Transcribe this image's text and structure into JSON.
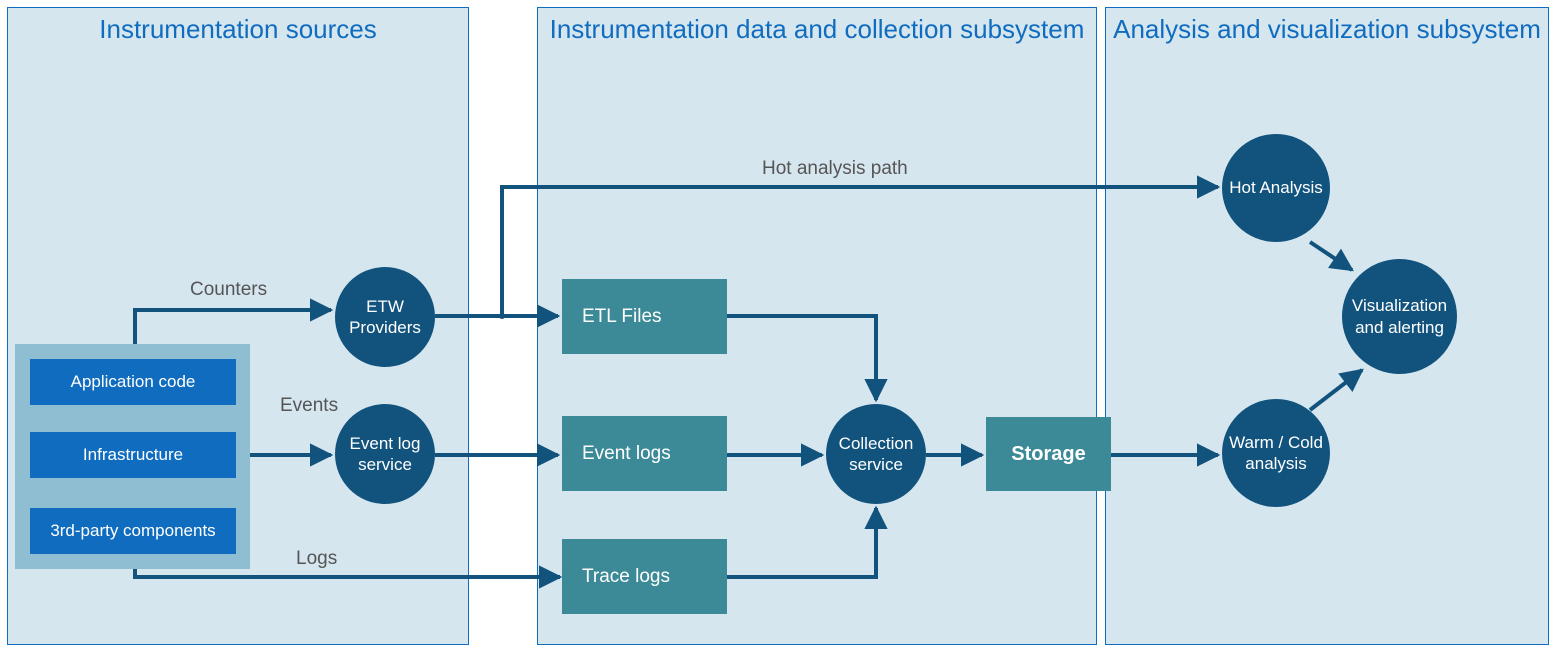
{
  "panels": {
    "sources": {
      "title": "Instrumentation sources"
    },
    "collection": {
      "title": "Instrumentation data and collection subsystem"
    },
    "analysis": {
      "title": "Analysis and visualization subsystem"
    }
  },
  "sources": {
    "app": "Application code",
    "infra": "Infrastructure",
    "third": "3rd-party components",
    "etw": "ETW Providers",
    "eventlog": "Event log service"
  },
  "collection": {
    "etl": "ETL Files",
    "evlog": "Event logs",
    "trace": "Trace logs",
    "collect": "Collection service",
    "storage": "Storage"
  },
  "analysis": {
    "hot": "Hot Analysis",
    "warmcold": "Warm / Cold analysis",
    "viz": "Visualization and alerting"
  },
  "edges": {
    "counters": "Counters",
    "events": "Events",
    "logs": "Logs",
    "hotpath": "Hot analysis path"
  }
}
